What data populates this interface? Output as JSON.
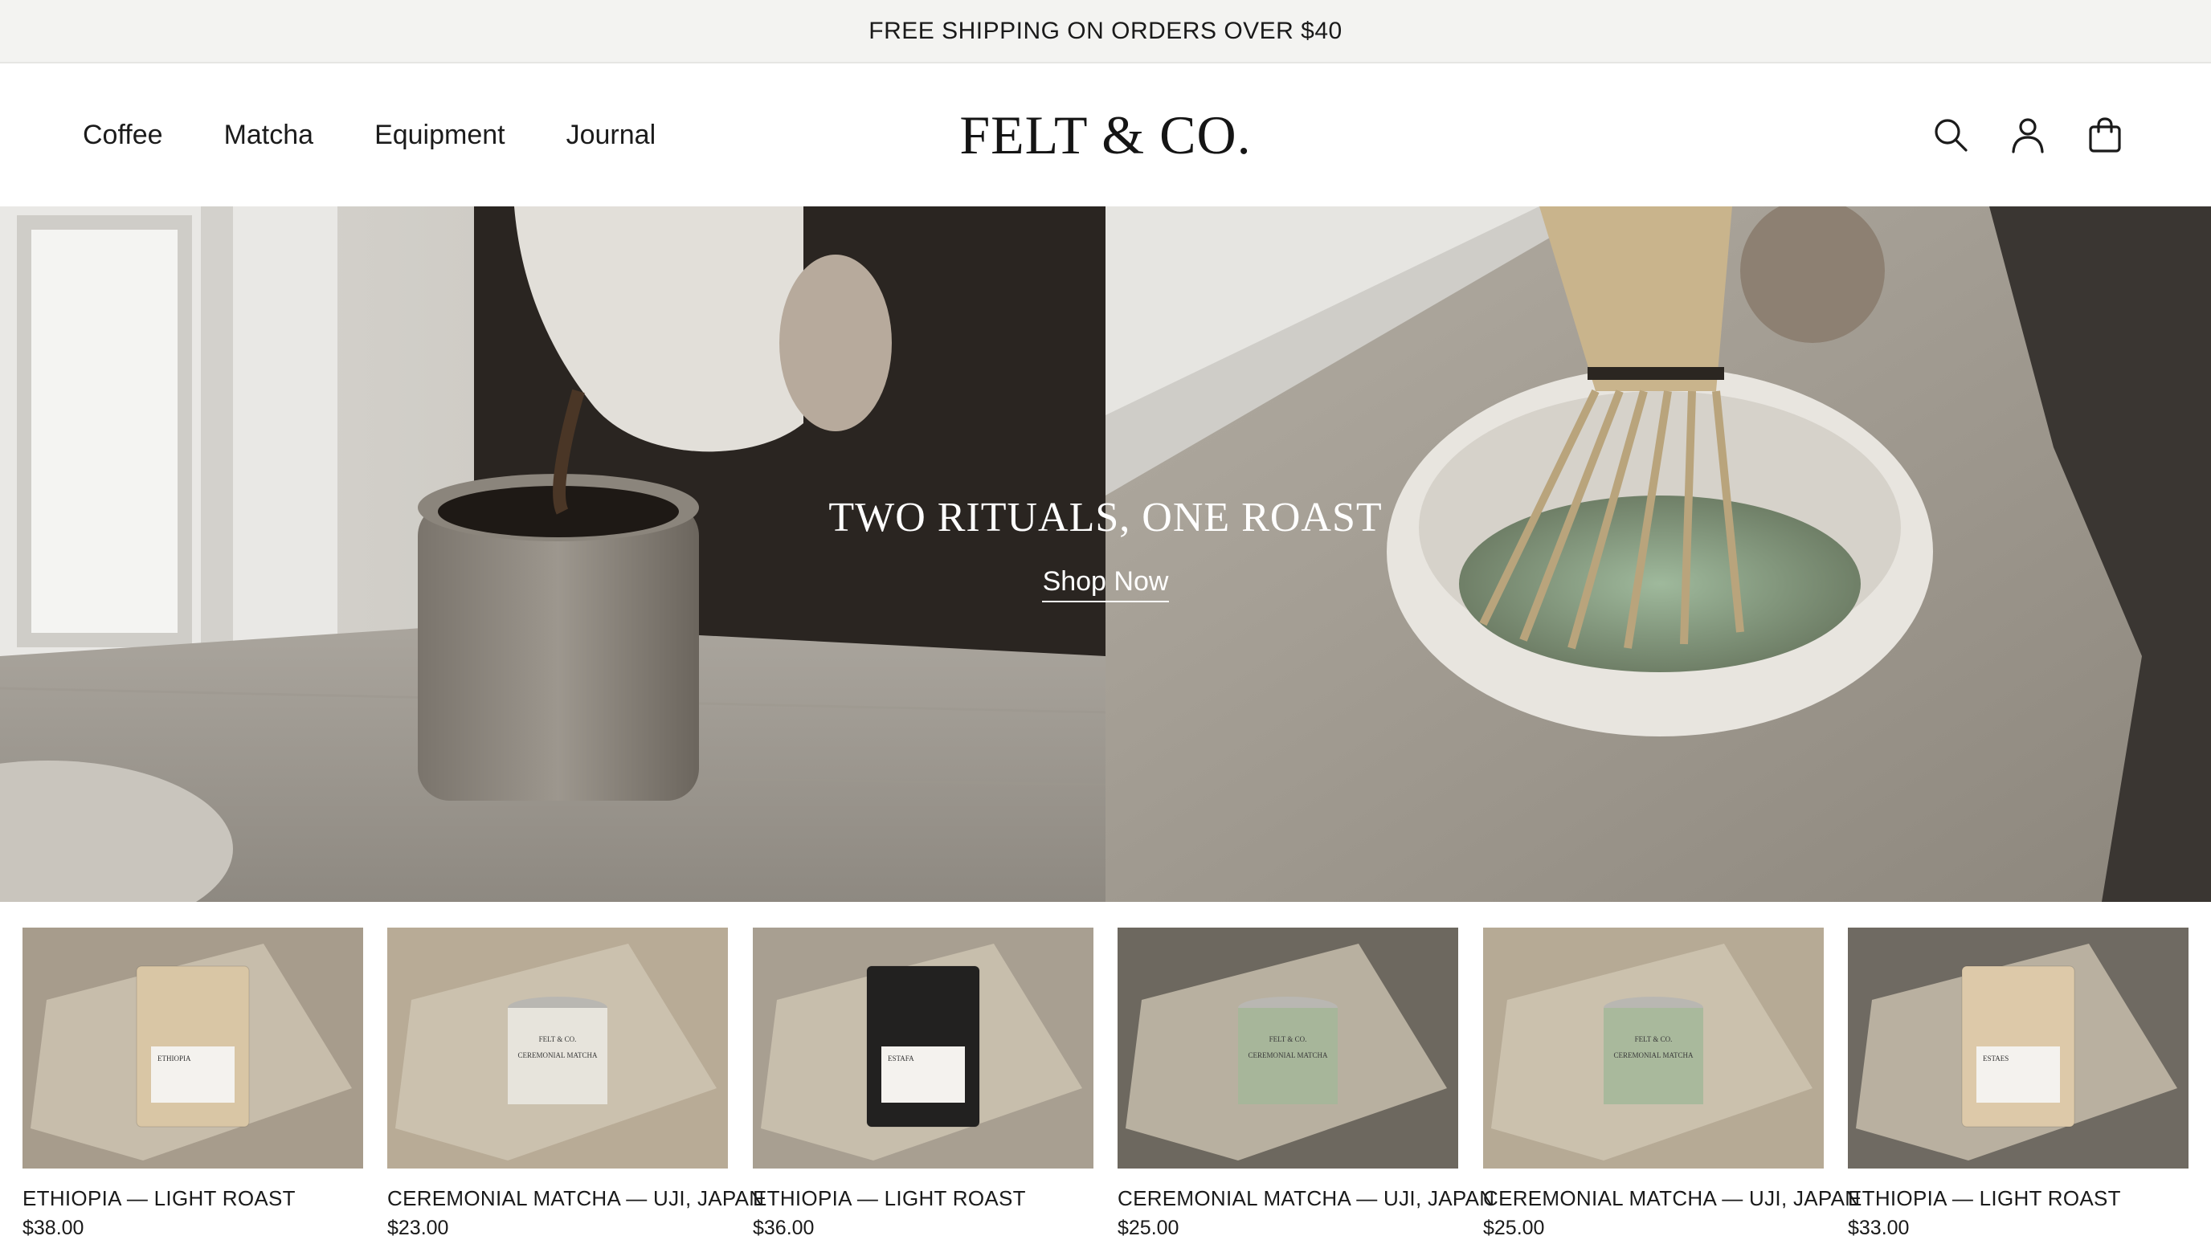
{
  "announcement": "FREE SHIPPING ON ORDERS OVER $40",
  "nav": [
    "Coffee",
    "Matcha",
    "Equipment",
    "Journal"
  ],
  "brand": "FELT & CO.",
  "header_icons": [
    "search-icon",
    "account-icon",
    "cart-icon"
  ],
  "hero": {
    "title": "TWO RITUALS, ONE ROAST",
    "cta": "Shop Now"
  },
  "products": [
    {
      "name": "ETHIOPIA — LIGHT ROAST",
      "price": "$38.00",
      "kind": "bag",
      "pack_label": "ETHIOPIA",
      "pack_color": "#d9c6a5",
      "surface": "#a79c8c"
    },
    {
      "name": "CEREMONIAL MATCHA — UJI, JAPAN",
      "price": "$23.00",
      "kind": "tin",
      "pack_brand": "FELT & CO.",
      "pack_label": "CEREMONIAL MATCHA",
      "pack_color": "#e7e4dc",
      "surface": "#b8ab96"
    },
    {
      "name": "ETHIOPIA — LIGHT ROAST",
      "price": "$36.00",
      "kind": "bag",
      "pack_label": "ESTAFA",
      "pack_color": "#222120",
      "surface": "#a89f91"
    },
    {
      "name": "CEREMONIAL MATCHA — UJI, JAPAN",
      "price": "$25.00",
      "kind": "tin",
      "pack_brand": "FELT & CO.",
      "pack_label": "CEREMONIAL MATCHA",
      "pack_color": "#a7b69a",
      "surface": "#6d685f"
    },
    {
      "name": "CEREMONIAL MATCHA — UJI, JAPAN",
      "price": "$25.00",
      "kind": "tin",
      "pack_brand": "FELT & CO.",
      "pack_label": "CEREMONIAL MATCHA",
      "pack_color": "#a9b99c",
      "surface": "#b6aa95"
    },
    {
      "name": "ETHIOPIA — LIGHT ROAST",
      "price": "$33.00",
      "kind": "bag",
      "pack_label": "ESTAES",
      "pack_color": "#ddc9a9",
      "surface": "#6f6a62"
    }
  ]
}
